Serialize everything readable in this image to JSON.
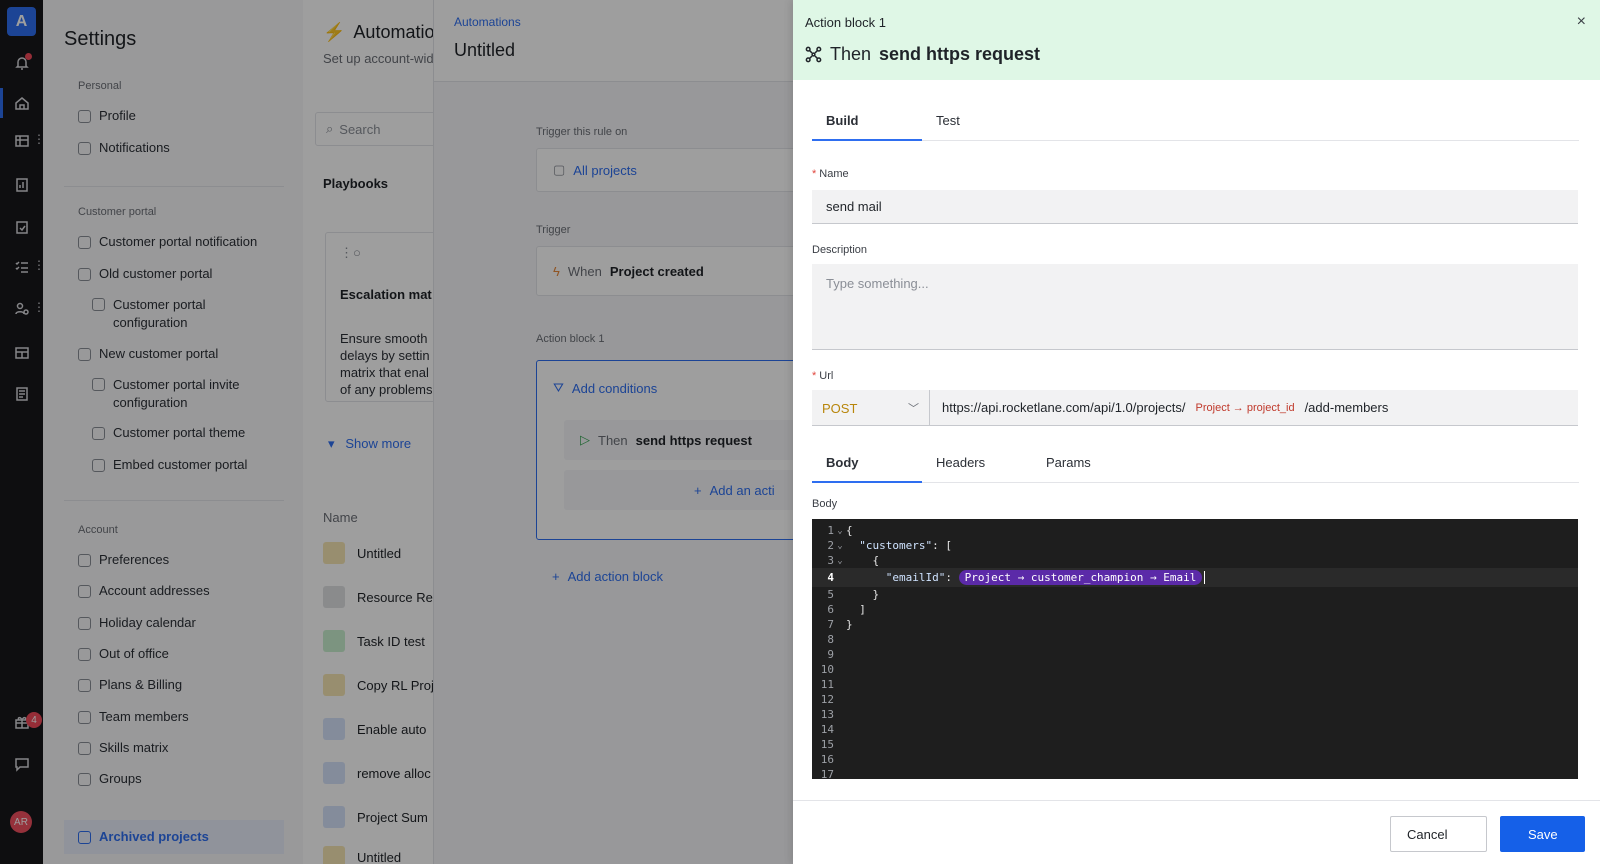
{
  "rail": {
    "logo": "A",
    "notification_badge": "4",
    "avatar_initials": "AR",
    "accent_color": "#2e6ef0"
  },
  "settings": {
    "title": "Settings",
    "personal_label": "Personal",
    "personal_items": [
      "Profile",
      "Notifications"
    ],
    "customer_portal_label": "Customer portal",
    "customer_portal_items": [
      "Customer portal notification",
      "Old customer portal",
      "Customer portal configuration",
      "New customer portal",
      "Customer portal invite configuration",
      "Customer portal theme",
      "Embed customer portal"
    ],
    "account_label": "Account",
    "account_items": [
      "Preferences",
      "Account addresses",
      "Holiday calendar",
      "Out of office",
      "Plans & Billing",
      "Team members",
      "Skills matrix",
      "Groups"
    ],
    "archived": "Archived projects"
  },
  "automations": {
    "title": "Automatio",
    "subtitle": "Set up account-wid",
    "search_placeholder": "Search",
    "playbooks": "Playbooks",
    "card_title": "Escalation mat",
    "card_desc": [
      "Ensure smooth",
      "delays by settin",
      "matrix that enal",
      "of any problems"
    ],
    "show_more": "Show more",
    "name_header": "Name",
    "rows": [
      "Untitled",
      "Resource Re",
      "Task ID test",
      "Copy RL Proj",
      "Enable auto",
      "remove alloc",
      "Project Sum",
      "Untitled"
    ]
  },
  "editor": {
    "breadcrumb": "Automations",
    "title": "Untitled",
    "trigger_on_label": "Trigger this rule on",
    "trigger_on_value": "All projects",
    "trigger_label": "Trigger",
    "trigger_prefix": "When",
    "trigger_value": "Project created",
    "action_label": "Action block 1",
    "add_conditions": "Add conditions",
    "then_prefix": "Then",
    "then_value": "send https request",
    "add_action": "Add an acti",
    "add_action_block": "Add action block"
  },
  "drawer": {
    "small_title": "Action block 1",
    "then_prefix": "Then",
    "then_value": "send https request",
    "close": "×",
    "tabs": [
      "Build",
      "Test"
    ],
    "name_label": "Name",
    "name_value": "send mail",
    "description_label": "Description",
    "description_placeholder": "Type something...",
    "url_label": "Url",
    "method": "POST",
    "url_prefix": "https://api.rocketlane.com/api/1.0/projects/",
    "url_token": "Project → project_id",
    "url_suffix": "/add-members",
    "body_tabs": [
      "Body",
      "Headers",
      "Params"
    ],
    "body_label": "Body",
    "code": {
      "line1": "{",
      "line2_key": "\"customers\"",
      "line2_rest": ": [",
      "line3": "{",
      "line4_key": "\"emailId\"",
      "line4_sep": ": ",
      "line4_token": "Project → customer_champion → Email",
      "line5": "}",
      "line6": "]",
      "line7": "}",
      "line_numbers": [
        "1",
        "2",
        "3",
        "4",
        "5",
        "6",
        "7",
        "8",
        "9",
        "10",
        "11",
        "12",
        "13",
        "14",
        "15",
        "16",
        "17"
      ]
    },
    "cancel": "Cancel",
    "save": "Save"
  }
}
